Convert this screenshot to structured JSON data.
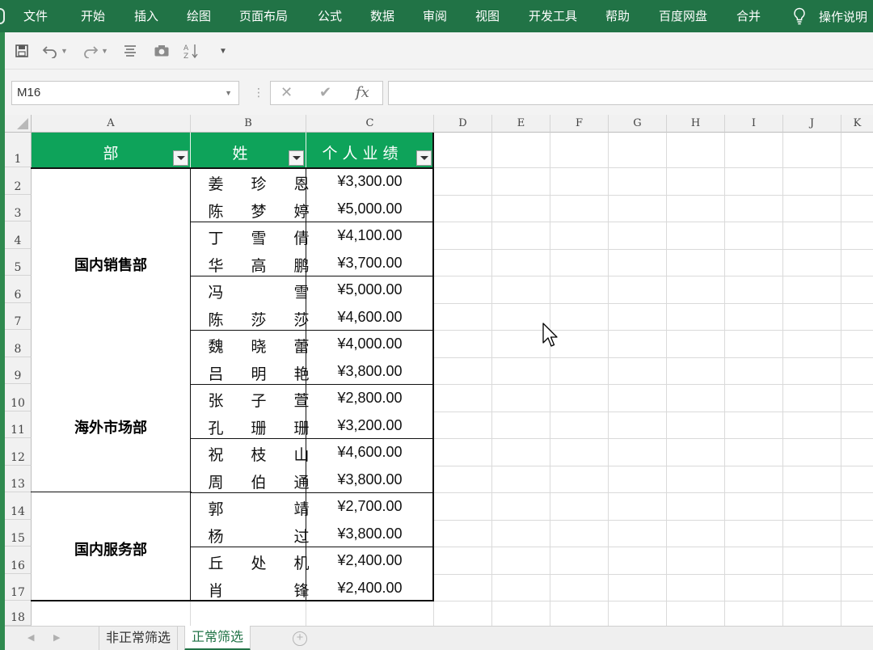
{
  "ribbon": {
    "tabs": [
      "文件",
      "开始",
      "插入",
      "绘图",
      "页面布局",
      "公式",
      "数据",
      "审阅",
      "视图",
      "开发工具",
      "帮助",
      "百度网盘",
      "合并"
    ],
    "tell_me": "操作说明"
  },
  "formula_bar": {
    "name_box": "M16",
    "cancel_symbol": "✕",
    "enter_symbol": "✔",
    "fx_symbol": "fx",
    "value": ""
  },
  "columns": [
    "A",
    "B",
    "C",
    "D",
    "E",
    "F",
    "G",
    "H",
    "I",
    "J",
    "K"
  ],
  "rows": [
    "1",
    "2",
    "3",
    "4",
    "5",
    "6",
    "7",
    "8",
    "9",
    "10",
    "11",
    "12",
    "13",
    "14",
    "15",
    "16",
    "17",
    "18"
  ],
  "table": {
    "headers": {
      "department": "部 门",
      "name": "姓 名",
      "performance": "个人业绩"
    },
    "departments": [
      "国内销售部",
      "海外市场部",
      "国内服务部"
    ],
    "records": [
      {
        "name": "姜珍恩",
        "amount": "¥3,300.00"
      },
      {
        "name": "陈梦婷",
        "amount": "¥5,000.00"
      },
      {
        "name": "丁雪倩",
        "amount": "¥4,100.00"
      },
      {
        "name": "华高鹏",
        "amount": "¥3,700.00"
      },
      {
        "name": "冯 雪",
        "amount": "¥5,000.00"
      },
      {
        "name": "陈莎莎",
        "amount": "¥4,600.00"
      },
      {
        "name": "魏晓蕾",
        "amount": "¥4,000.00"
      },
      {
        "name": "吕明艳",
        "amount": "¥3,800.00"
      },
      {
        "name": "张子萱",
        "amount": "¥2,800.00"
      },
      {
        "name": "孔珊珊",
        "amount": "¥3,200.00"
      },
      {
        "name": "祝枝山",
        "amount": "¥4,600.00"
      },
      {
        "name": "周伯通",
        "amount": "¥3,800.00"
      },
      {
        "name": "郭 靖",
        "amount": "¥2,700.00"
      },
      {
        "name": "杨 过",
        "amount": "¥3,800.00"
      },
      {
        "name": "丘处机",
        "amount": "¥2,400.00"
      },
      {
        "name": "肖 锋",
        "amount": "¥2,400.00"
      }
    ]
  },
  "sheet_tabs": [
    "非正常筛选",
    "正常筛选"
  ],
  "active_sheet": "正常筛选",
  "colors": {
    "ribbon": "#217346",
    "header_fill": "#0ea35a"
  }
}
